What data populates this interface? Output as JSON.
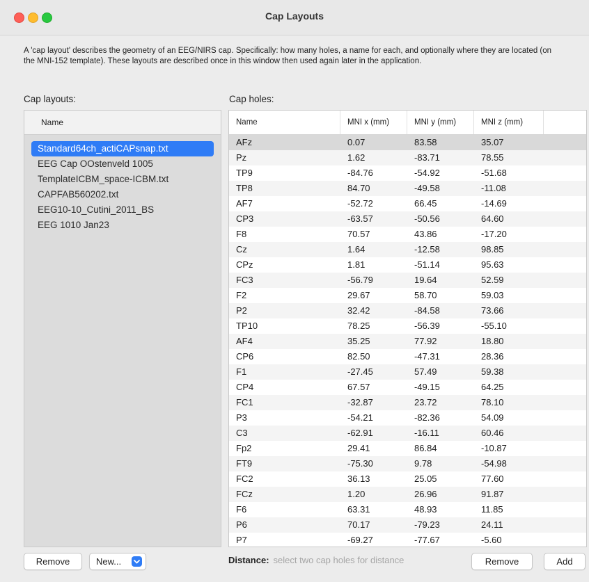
{
  "window": {
    "title": "Cap Layouts"
  },
  "description": "A 'cap layout' describes the geometry of an EEG/NIRS cap. Specifically: how many holes, a name for each, and optionally where they are located (on the MNI-152 template). These layouts are described once in this window then used again later in the application.",
  "left": {
    "label": "Cap layouts:",
    "column_header": "Name",
    "items": [
      "Standard64ch_actiCAPsnap.txt",
      "EEG Cap OOstenveld 1005",
      "TemplateICBM_space-ICBM.txt",
      "CAPFAB560202.txt",
      "EEG10-10_Cutini_2011_BS",
      "EEG 1010 Jan23"
    ],
    "remove_label": "Remove",
    "new_label": "New..."
  },
  "right": {
    "label": "Cap holes:",
    "headers": [
      "Name",
      "MNI x (mm)",
      "MNI y (mm)",
      "MNI z (mm)"
    ],
    "rows": [
      [
        "AFz",
        "0.07",
        "83.58",
        "35.07"
      ],
      [
        "Pz",
        "1.62",
        "-83.71",
        "78.55"
      ],
      [
        "TP9",
        "-84.76",
        "-54.92",
        "-51.68"
      ],
      [
        "TP8",
        "84.70",
        "-49.58",
        "-11.08"
      ],
      [
        "AF7",
        "-52.72",
        "66.45",
        "-14.69"
      ],
      [
        "CP3",
        "-63.57",
        "-50.56",
        "64.60"
      ],
      [
        "F8",
        "70.57",
        "43.86",
        "-17.20"
      ],
      [
        "Cz",
        "1.64",
        "-12.58",
        "98.85"
      ],
      [
        "CPz",
        "1.81",
        "-51.14",
        "95.63"
      ],
      [
        "FC3",
        "-56.79",
        "19.64",
        "52.59"
      ],
      [
        "F2",
        "29.67",
        "58.70",
        "59.03"
      ],
      [
        "P2",
        "32.42",
        "-84.58",
        "73.66"
      ],
      [
        "TP10",
        "78.25",
        "-56.39",
        "-55.10"
      ],
      [
        "AF4",
        "35.25",
        "77.92",
        "18.80"
      ],
      [
        "CP6",
        "82.50",
        "-47.31",
        "28.36"
      ],
      [
        "F1",
        "-27.45",
        "57.49",
        "59.38"
      ],
      [
        "CP4",
        "67.57",
        "-49.15",
        "64.25"
      ],
      [
        "FC1",
        "-32.87",
        "23.72",
        "78.10"
      ],
      [
        "P3",
        "-54.21",
        "-82.36",
        "54.09"
      ],
      [
        "C3",
        "-62.91",
        "-16.11",
        "60.46"
      ],
      [
        "Fp2",
        "29.41",
        "86.84",
        "-10.87"
      ],
      [
        "FT9",
        "-75.30",
        "9.78",
        "-54.98"
      ],
      [
        "FC2",
        "36.13",
        "25.05",
        "77.60"
      ],
      [
        "FCz",
        "1.20",
        "26.96",
        "91.87"
      ],
      [
        "F6",
        "63.31",
        "48.93",
        "11.85"
      ],
      [
        "P6",
        "70.17",
        "-79.23",
        "24.11"
      ],
      [
        "P7",
        "-69.27",
        "-77.67",
        "-5.60"
      ]
    ],
    "distance_label": "Distance:",
    "distance_hint": "select two cap holes for distance",
    "remove_label": "Remove",
    "add_label": "Add"
  },
  "colors": {
    "selection_accent": "#2f7cf6",
    "row_selected": "#d9d9d9",
    "close": "#fe5f57",
    "minimize": "#febc2e",
    "zoom": "#28c840"
  }
}
